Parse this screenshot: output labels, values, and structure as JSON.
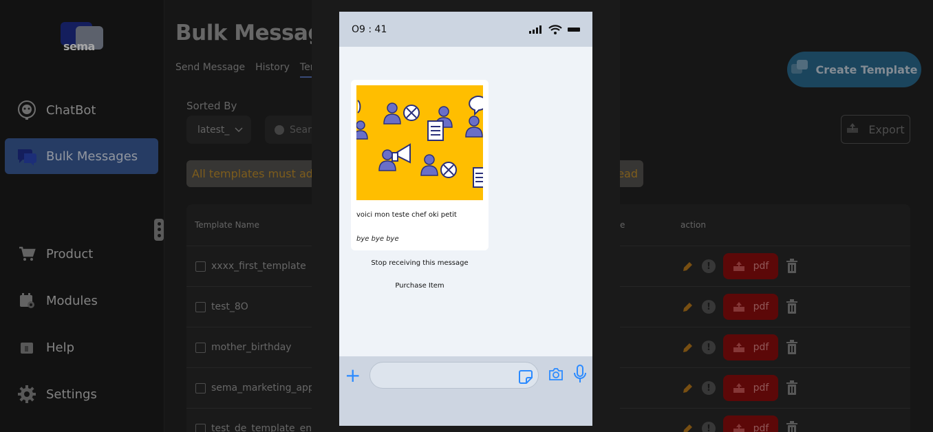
{
  "sidebar": {
    "logo_text": "sema",
    "items": [
      {
        "label": "ChatBot",
        "icon": "robot-headset-icon"
      },
      {
        "label": "Bulk Messages",
        "icon": "chat-bubbles-icon",
        "active": true
      },
      {
        "label": "Product",
        "icon": "cart-icon"
      },
      {
        "label": "Modules",
        "icon": "calendar-gear-icon"
      },
      {
        "label": "Help",
        "icon": "help-icon"
      },
      {
        "label": "Settings",
        "icon": "gear-icon"
      }
    ]
  },
  "header": {
    "title": "Bulk Message",
    "tabs": [
      "Send Message",
      "History",
      "Temp"
    ],
    "create_button": "Create Template"
  },
  "controls": {
    "sorted_label": "Sorted By",
    "sort_value": "latest_",
    "search_placeholder": "Sear",
    "export_label": "Export"
  },
  "notice": {
    "text_left": "All templates must adhe",
    "text_right": "ead"
  },
  "table": {
    "headers": {
      "name": "Template Name",
      "partial": "e",
      "action": "action"
    },
    "rows": [
      {
        "name": "xxxx_first_template"
      },
      {
        "name": "test_8O"
      },
      {
        "name": "mother_birthday"
      },
      {
        "name": "sema_marketing_app"
      },
      {
        "name": "test_de_template_en"
      }
    ],
    "pdf_label": "pdf",
    "warn_glyph": "!"
  },
  "preview": {
    "time": "O9 : 41",
    "body": "voici mon teste chef oki petit",
    "footer": "bye bye bye",
    "quick_replies": [
      "Stop receiving this message",
      "Purchase Item"
    ],
    "plus_glyph": "+"
  },
  "colors": {
    "accent": "#3b5d9a",
    "create_button": "#2a6b8f",
    "pdf_button": "#8e0d0d",
    "image_bg": "#ffbe00",
    "whatsapp_blue": "#2b8aff"
  }
}
